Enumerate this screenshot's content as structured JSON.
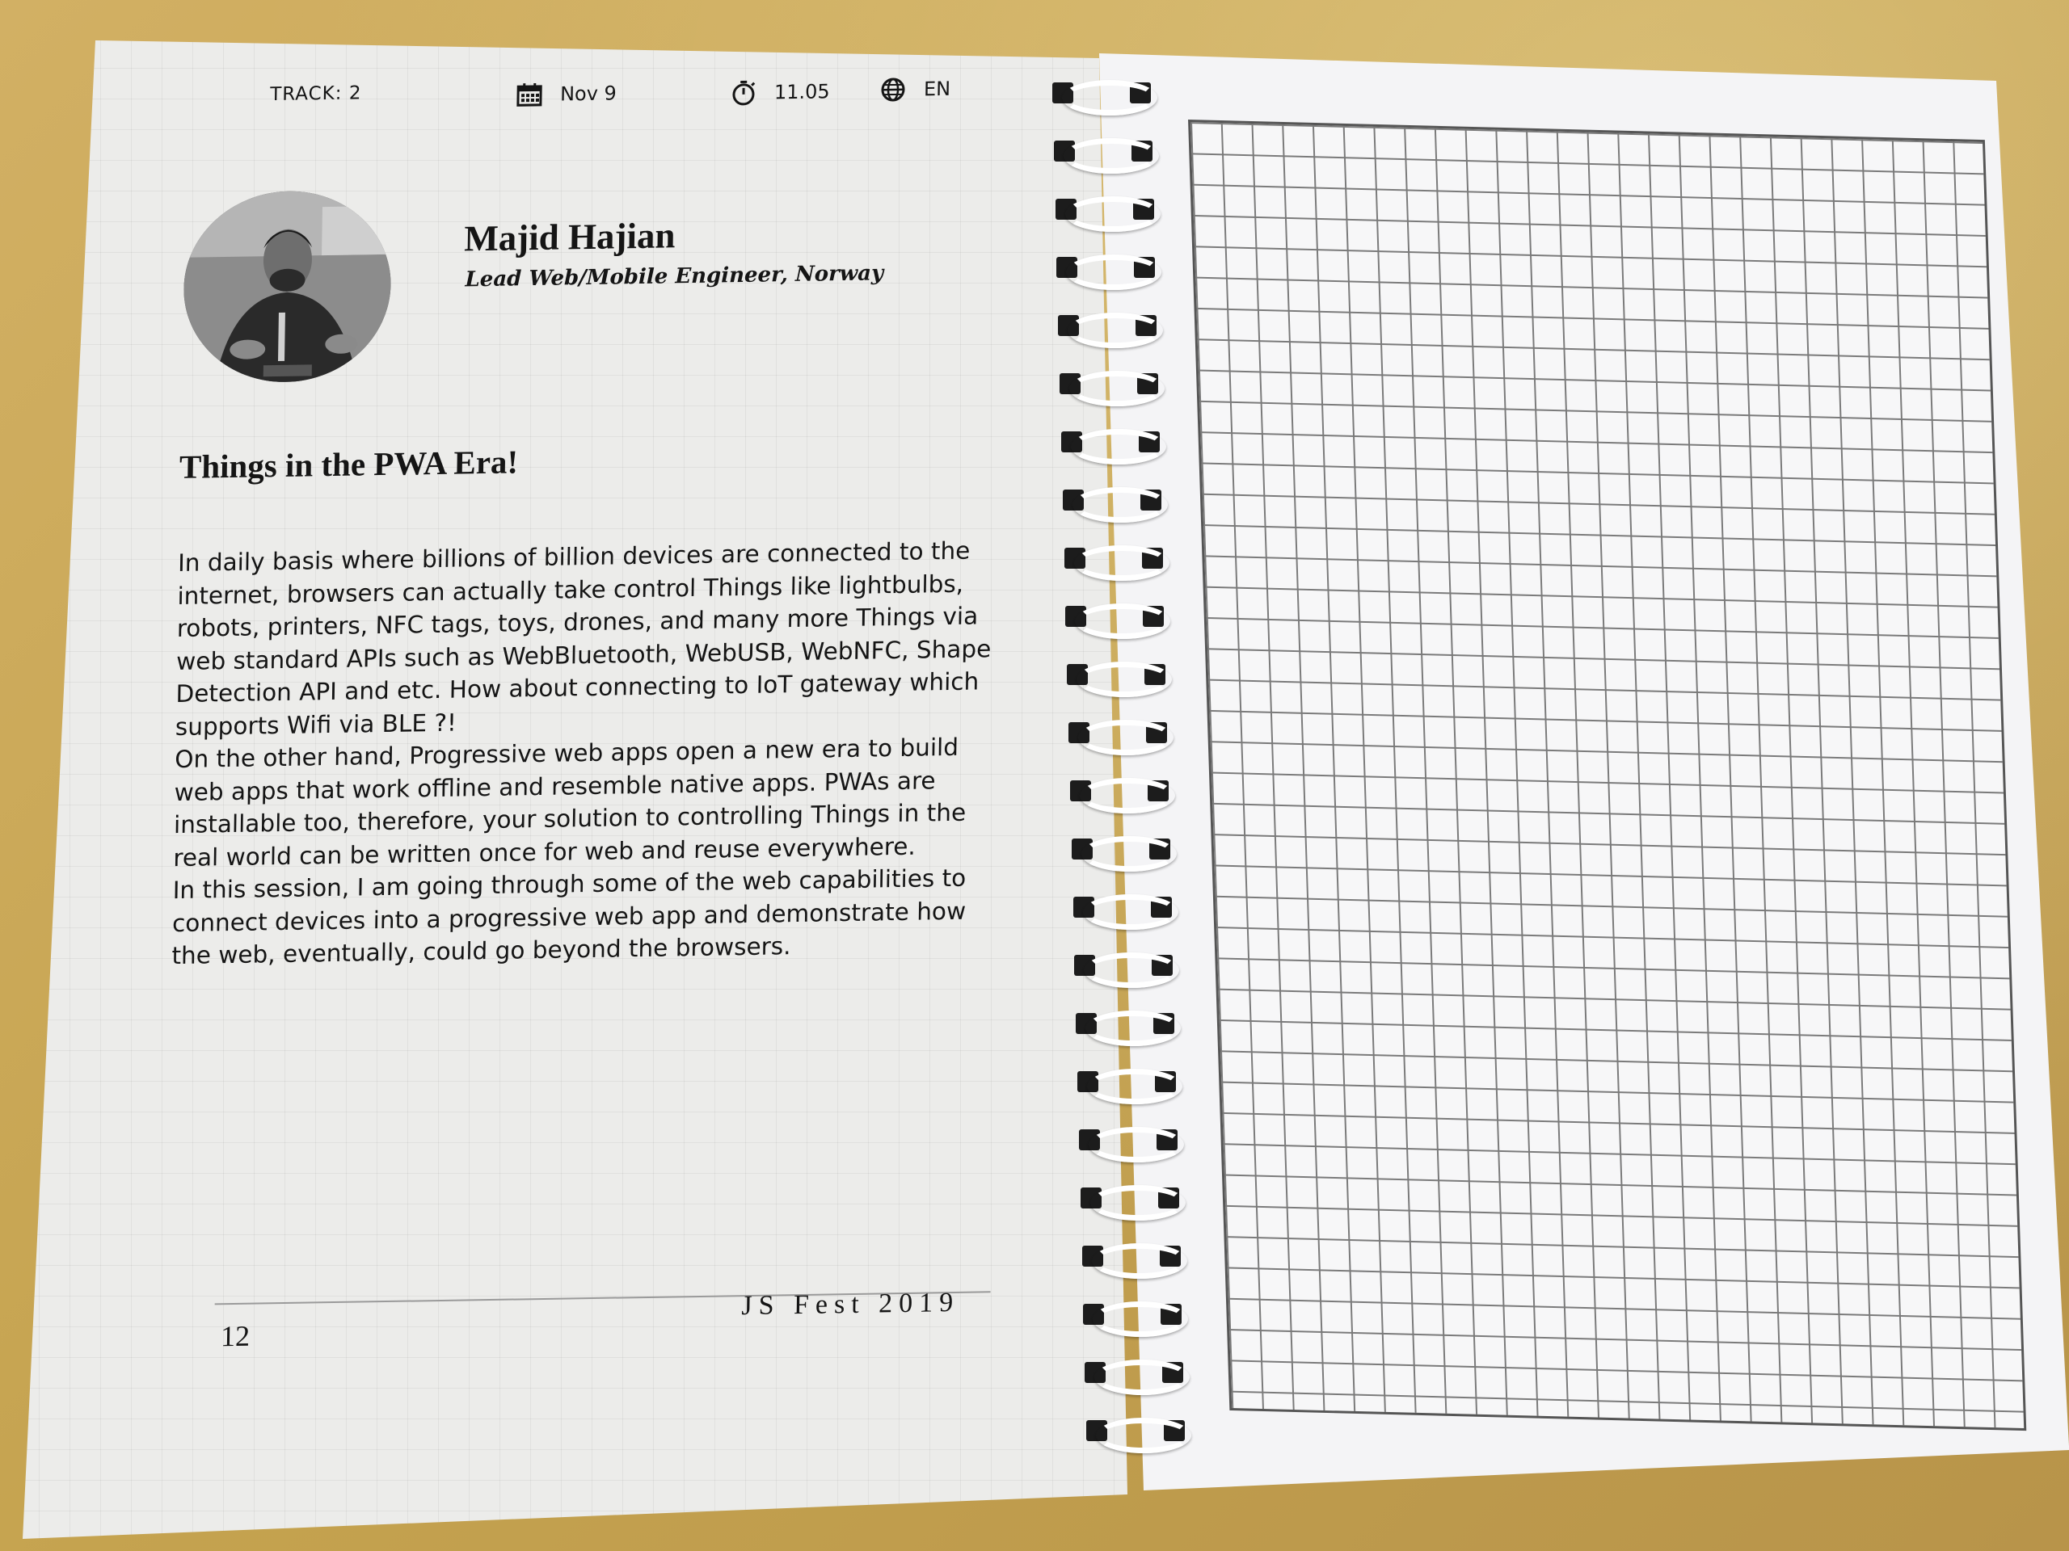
{
  "left_page": {
    "header": {
      "track": "TRACK: 2",
      "date": "Nov 9",
      "time": "11.05",
      "language": "EN"
    },
    "speaker": {
      "name": "Majid Hajian",
      "role": "Lead Web/Mobile Engineer, Norway"
    },
    "talk": {
      "title": "Things in the PWA Era!",
      "paragraphs": [
        "In daily basis where billions of billion devices are connected to the internet, browsers can actually take control Things like lightbulbs, robots, printers, NFC tags, toys, drones, and many more Things via web standard APIs such as WebBluetooth, WebUSB, WebNFC, Shape Detection API and etc. How about connecting to IoT gateway which supports Wifi via BLE ?!",
        "On the other hand, Progressive web apps open a new era to build web apps that work offline and resemble native apps. PWAs are installable too, therefore, your solution to controlling Things in the real world can be written once for web and reuse everywhere.",
        "In this session, I am going through some of the web capabilities to connect devices into a progressive web app and demonstrate how the web, eventually, could go beyond the browsers."
      ]
    },
    "footer": {
      "page_number": "12",
      "brand": "JS Fest 2019"
    }
  },
  "icons": {
    "date": "calendar-icon",
    "time": "stopwatch-icon",
    "language": "globe-icon"
  },
  "colors": {
    "table": "#c8a857",
    "paper": "#ececea",
    "ink": "#151515",
    "spiral_wire": "#ffffff"
  },
  "spiral": {
    "ring_count": 24
  }
}
